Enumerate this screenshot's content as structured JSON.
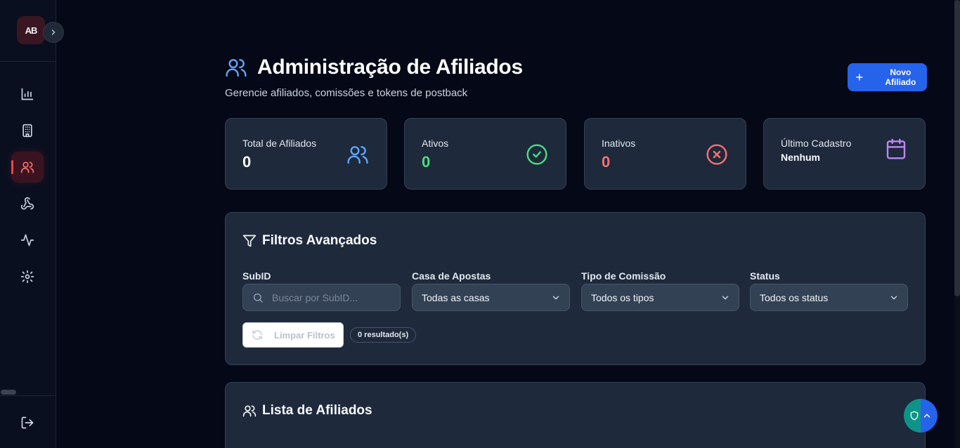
{
  "app": {
    "logo_text": "AB"
  },
  "sidebar": {
    "items": [
      {
        "icon": "bar-chart-icon",
        "active": false
      },
      {
        "icon": "building-icon",
        "active": false
      },
      {
        "icon": "users-icon",
        "active": true
      },
      {
        "icon": "webhook-icon",
        "active": false
      },
      {
        "icon": "activity-icon",
        "active": false
      },
      {
        "icon": "settings-icon",
        "active": false
      }
    ],
    "logout_icon": "logout-icon"
  },
  "header": {
    "title": "Administração de Afiliados",
    "subtitle": "Gerencie afiliados, comissões e tokens de postback",
    "new_button": "Novo Afiliado"
  },
  "stats": [
    {
      "label": "Total de Afiliados",
      "value": "0",
      "color": "#ffffff",
      "icon": "users-icon",
      "icon_color": "#60a5fa"
    },
    {
      "label": "Ativos",
      "value": "0",
      "color": "#4ade80",
      "icon": "check-circle-icon",
      "icon_color": "#4ade80"
    },
    {
      "label": "Inativos",
      "value": "0",
      "color": "#f87171",
      "icon": "x-circle-icon",
      "icon_color": "#f87171"
    },
    {
      "label": "Último Cadastro",
      "value": "Nenhum",
      "color": "#f8fafc",
      "icon": "calendar-icon",
      "icon_color": "#c084fc"
    }
  ],
  "filters": {
    "title": "Filtros Avançados",
    "subid": {
      "label": "SubID",
      "placeholder": "Buscar por SubID...",
      "value": ""
    },
    "casa": {
      "label": "Casa de Apostas",
      "selected": "Todas as casas"
    },
    "tipo": {
      "label": "Tipo de Comissão",
      "selected": "Todos os tipos"
    },
    "status": {
      "label": "Status",
      "selected": "Todos os status"
    },
    "clear_button": "Limpar Filtros",
    "result_badge": "0 resultado(s)"
  },
  "list": {
    "title": "Lista de Afiliados"
  },
  "colors": {
    "accent": "#2563eb",
    "danger": "#ef4444",
    "panel": "#1e293b",
    "background": "#050816"
  }
}
